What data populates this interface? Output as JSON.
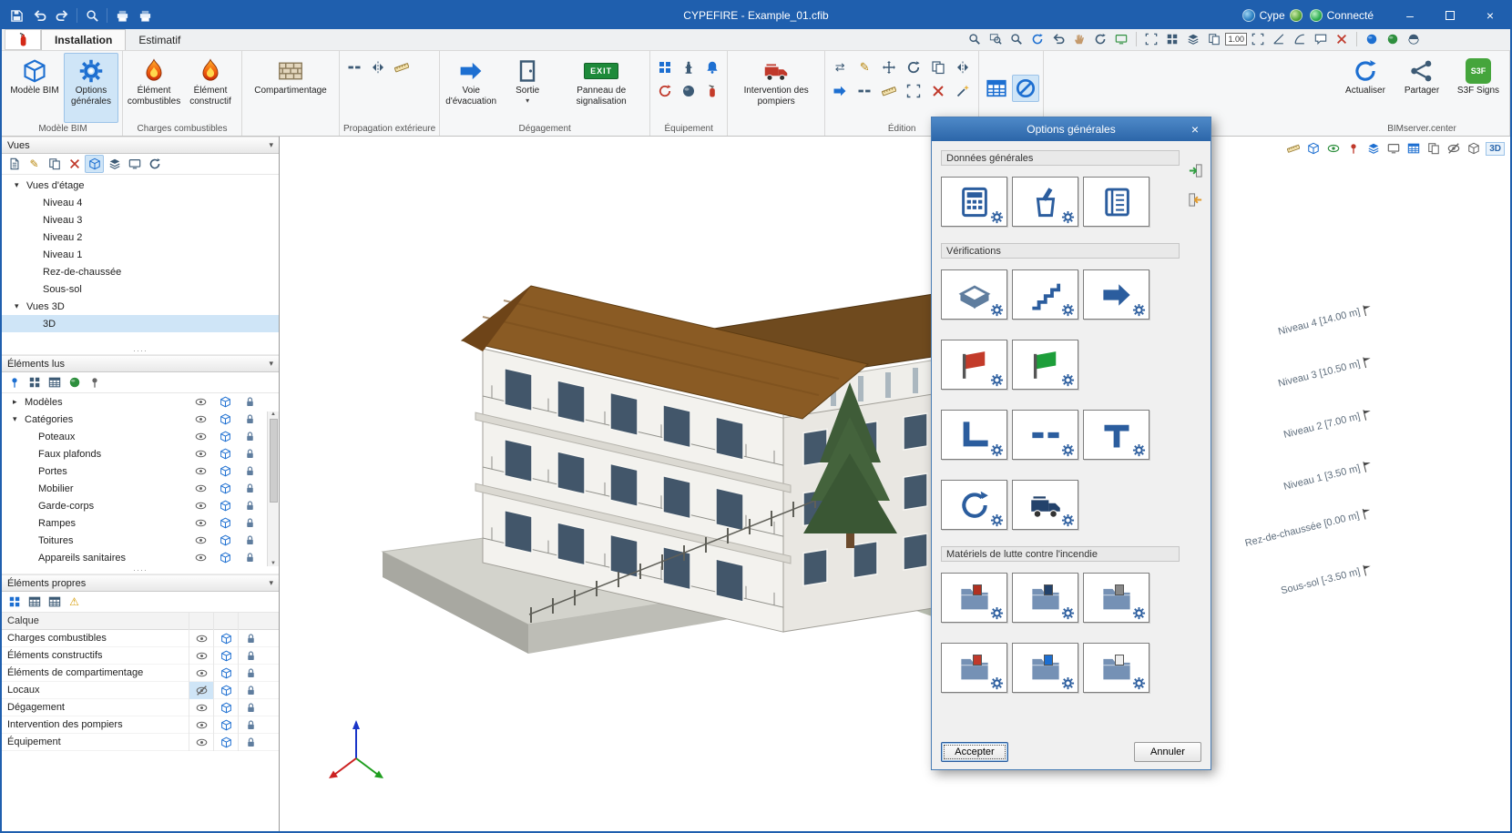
{
  "window": {
    "title": "CYPEFIRE - Example_01.cfib",
    "account": "Cype",
    "status": "Connecté"
  },
  "icons": {
    "expanded": "▾",
    "collapsed": "▸",
    "panel_chevron": "▾",
    "close": "×",
    "minimize": "–",
    "dots": "····",
    "warning": "⚠",
    "pencil": "✎",
    "swap": "⇄",
    "scroll_up": "▲",
    "scroll_down": "▼"
  },
  "tabs": {
    "installation": "Installation",
    "estimatif": "Estimatif"
  },
  "topbar": {
    "scale_label": "1.00"
  },
  "ribbon": {
    "modele_bim": "Modèle BIM",
    "options_generales": "Options générales",
    "element_combustibles": "Élément combustibles",
    "element_constructif": "Élément constructif",
    "compartimentage": "Compartimentage",
    "voie_evacuation": "Voie d'évacuation",
    "sortie": "Sortie",
    "panneau_signalisation": "Panneau de signalisation",
    "exit_label": "EXIT",
    "intervention_pompiers": "Intervention des pompiers",
    "actualiser": "Actualiser",
    "partager": "Partager",
    "s3f_signs": "S3F Signs",
    "s3f_badge": "S3F",
    "groups": {
      "modele_bim": "Modèle BIM",
      "charges_combustibles": "Charges combustibles",
      "propagation_exterieure": "Propagation extérieure",
      "degagement": "Dégagement",
      "equipement": "Équipement",
      "edition": "Édition",
      "bimserver": "BIMserver.center"
    }
  },
  "sidebar": {
    "vues": {
      "title": "Vues",
      "group_etage": "V­ues d'étage",
      "etages": [
        "Niveau 4",
        "Niveau 3",
        "Niveau 2",
        "Niveau 1",
        "Rez-de-chaussée",
        "Sous-sol"
      ],
      "group_3d": "Vues 3D",
      "item_3d": "3D"
    },
    "elements_lus": {
      "title": "Éléments lus",
      "modeles": "Modèles",
      "categories": "Catégories",
      "items": [
        "Poteaux",
        "Faux plafonds",
        "Portes",
        "Mobilier",
        "Garde-corps",
        "Rampes",
        "Toitures",
        "Appareils sanitaires"
      ]
    },
    "elements_propres": {
      "title": "Éléments propres",
      "col_calque": "Calque",
      "rows": [
        "Charges combustibles",
        "Éléments constructifs",
        "Éléments de compartimentage",
        "Locaux",
        "Dégagement",
        "Intervention des pompiers",
        "Équipement"
      ]
    }
  },
  "viewport": {
    "badge_3d": "3D",
    "levels": [
      "Niveau 4 [14.00 m]",
      "Niveau 3 [10.50 m]",
      "Niveau 2 [7.00 m]",
      "Niveau 1 [3.50 m]",
      "Rez-de-chaussée [0.00 m]",
      "Sous-sol [-3.50 m]"
    ]
  },
  "dialog": {
    "title": "Options générales",
    "sections": {
      "donnees": "Données générales",
      "verifications": "Vérifications",
      "materiels": "Matériels de lutte contre l'incendie"
    },
    "accept": "Accepter",
    "cancel": "Annuler"
  },
  "colors": {
    "titlebar": "#1f5fae",
    "selection": "#cfe5f7",
    "dialog_titlebar": "#2f6db8",
    "accent_blue": "#2d68ad",
    "fire_orange": "#f2600f",
    "exit_green": "#1d8a3a"
  }
}
